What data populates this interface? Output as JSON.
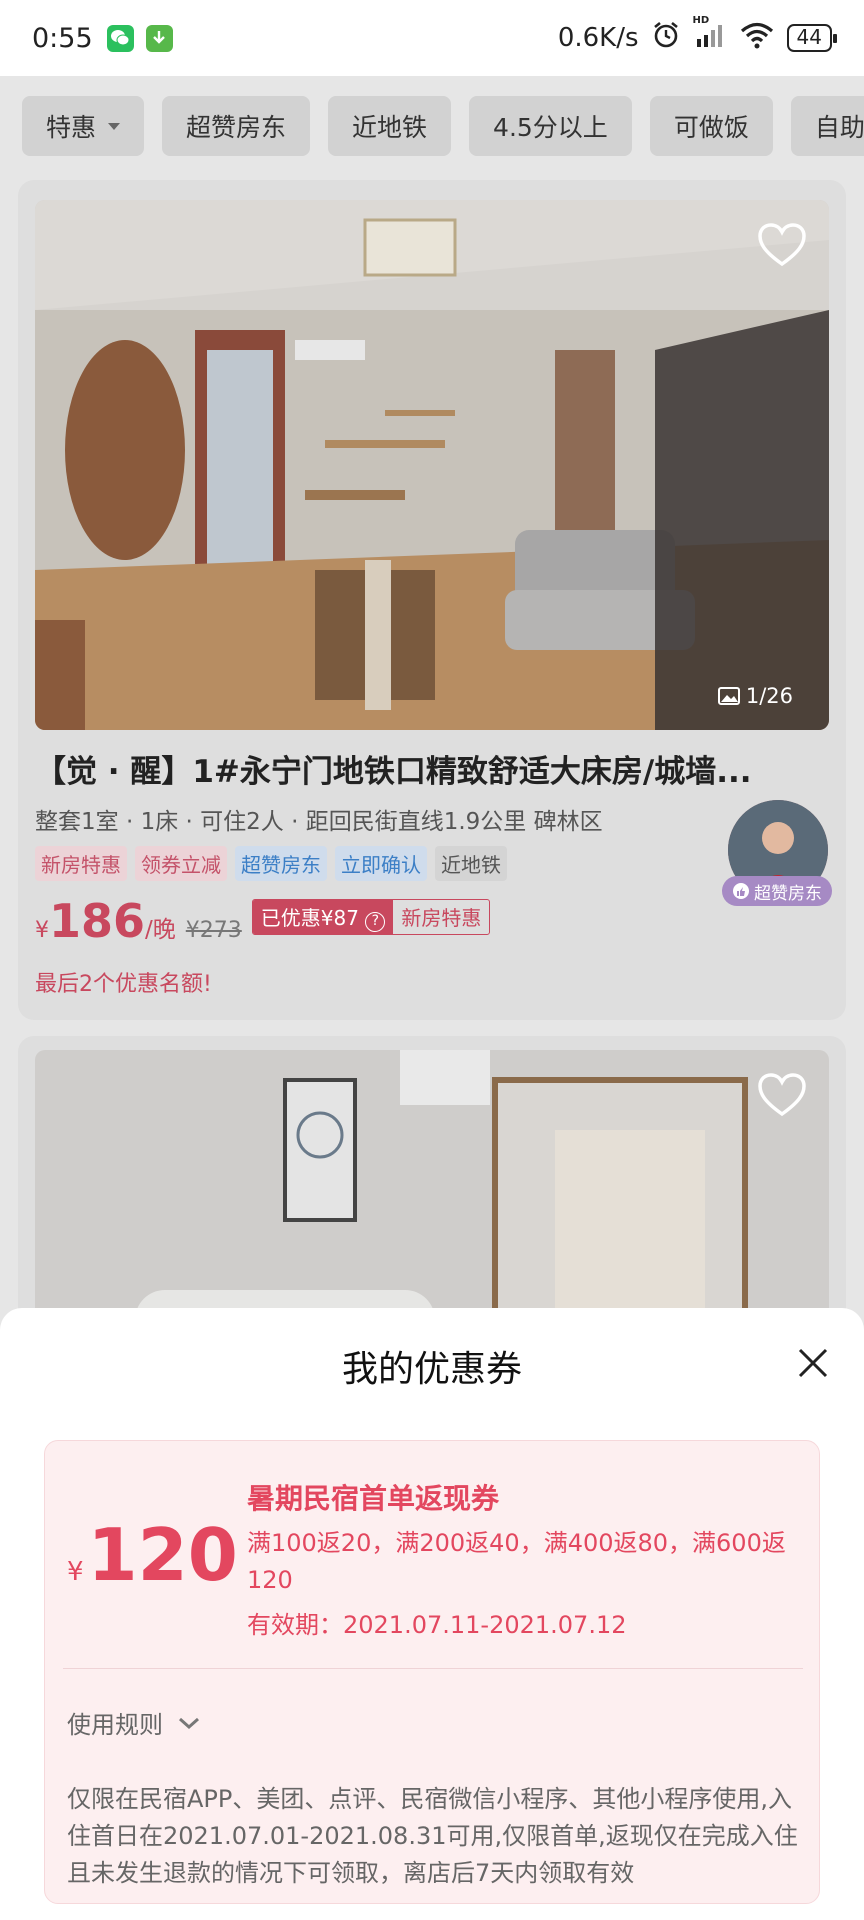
{
  "status_bar": {
    "time": "0:55",
    "speed": "0.6K/s",
    "hd_label": "HD",
    "battery": "44",
    "icons": [
      "wechat-icon",
      "download-icon",
      "alarm-icon",
      "signal-icon",
      "wifi-icon",
      "battery-icon"
    ]
  },
  "filters": [
    {
      "label": "特惠",
      "has_dropdown": true
    },
    {
      "label": "超赞房东"
    },
    {
      "label": "近地铁"
    },
    {
      "label": "4.5分以上"
    },
    {
      "label": "可做饭"
    },
    {
      "label": "自助入住"
    }
  ],
  "listing": {
    "image_counter": "1/26",
    "title": "【觉 · 醒】1#永宁门地铁口精致舒适大床房/城墙...",
    "subtitle": "整套1室 · 1床 · 可住2人 · 距回民街直线1.9公里 碑林区",
    "tags": [
      {
        "label": "新房特惠",
        "style": "red"
      },
      {
        "label": "领券立减",
        "style": "red"
      },
      {
        "label": "超赞房东",
        "style": "blue"
      },
      {
        "label": "立即确认",
        "style": "blue"
      },
      {
        "label": "近地铁",
        "style": "gray"
      }
    ],
    "price_symbol": "¥",
    "price": "186",
    "price_unit": "/晚",
    "original_price": "¥273",
    "discount_label": "已优惠¥87",
    "discount_help": "?",
    "promo_label": "新房特惠",
    "scarcity": "最后2个优惠名额!",
    "host_badge": "超赞房东"
  },
  "sheet": {
    "title": "我的优惠券",
    "coupon": {
      "symbol": "¥",
      "amount": "120",
      "name": "暑期民宿首单返现券",
      "description": "满100返20，满200返40，满400返80，满600返120",
      "validity": "有效期：2021.07.11-2021.07.12",
      "rules_label": "使用规则",
      "rules_text": "仅限在民宿APP、美团、点评、民宿微信小程序、其他小程序使用,入住首日在2021.07.01-2021.08.31可用,仅限首单,返现仅在完成入住且未发生退款的情况下可领取，离店后7天内领取有效"
    }
  },
  "colors": {
    "accent": "#e3475f",
    "coupon_bg": "#fdeff0"
  }
}
